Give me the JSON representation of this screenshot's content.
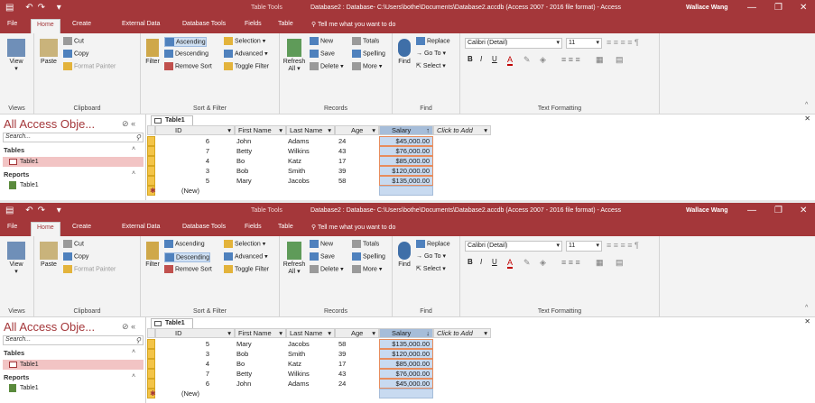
{
  "window_title": "Database2 : Database- C:\\Users\\bothe\\Documents\\Database2.accdb (Access 2007 - 2016 file format) - Access",
  "context_tab": "Table Tools",
  "user_name": "Wallace Wang",
  "tabs": [
    "File",
    "Home",
    "Create",
    "External Data",
    "Database Tools",
    "Fields",
    "Table"
  ],
  "tell_me": "Tell me what you want to do",
  "ribbon": {
    "views": {
      "view": "View",
      "label": "Views"
    },
    "clipboard": {
      "paste": "Paste",
      "cut": "Cut",
      "copy": "Copy",
      "format_painter": "Format Painter",
      "label": "Clipboard"
    },
    "sort_filter": {
      "filter": "Filter",
      "ascending": "Ascending",
      "descending": "Descending",
      "remove_sort": "Remove Sort",
      "selection": "Selection",
      "advanced": "Advanced",
      "toggle_filter": "Toggle Filter",
      "label": "Sort & Filter"
    },
    "records": {
      "refresh": "Refresh",
      "all": "All",
      "new": "New",
      "save": "Save",
      "delete": "Delete",
      "totals": "Totals",
      "spelling": "Spelling",
      "more": "More",
      "label": "Records"
    },
    "find": {
      "find": "Find",
      "replace": "Replace",
      "goto": "Go To",
      "select": "Select",
      "label": "Find"
    },
    "text_formatting": {
      "font": "Calibri (Detail)",
      "size": "11",
      "bold": "B",
      "italic": "I",
      "underline": "U",
      "font_color": "A",
      "label": "Text Formatting"
    }
  },
  "nav": {
    "header": "All Access Obje...",
    "search_placeholder": "Search...",
    "sections": [
      {
        "title": "Tables",
        "items": [
          "Table1"
        ]
      },
      {
        "title": "Reports",
        "items": [
          "Table1"
        ]
      }
    ]
  },
  "doc_tab": "Table1",
  "columns": [
    "ID",
    "First Name",
    "Last Name",
    "Age",
    "Salary",
    "Click to Add"
  ],
  "new_row_label": "(New)",
  "views": [
    {
      "sorted_by": "Ascending",
      "rows": [
        {
          "id": "6",
          "first": "John",
          "last": "Adams",
          "age": "24",
          "salary": "$45,000.00"
        },
        {
          "id": "7",
          "first": "Betty",
          "last": "Wilkins",
          "age": "43",
          "salary": "$76,000.00"
        },
        {
          "id": "4",
          "first": "Bo",
          "last": "Katz",
          "age": "17",
          "salary": "$85,000.00"
        },
        {
          "id": "3",
          "first": "Bob",
          "last": "Smith",
          "age": "39",
          "salary": "$120,000.00"
        },
        {
          "id": "5",
          "first": "Mary",
          "last": "Jacobs",
          "age": "58",
          "salary": "$135,000.00"
        }
      ]
    },
    {
      "sorted_by": "Descending",
      "rows": [
        {
          "id": "5",
          "first": "Mary",
          "last": "Jacobs",
          "age": "58",
          "salary": "$135,000.00"
        },
        {
          "id": "3",
          "first": "Bob",
          "last": "Smith",
          "age": "39",
          "salary": "$120,000.00"
        },
        {
          "id": "4",
          "first": "Bo",
          "last": "Katz",
          "age": "17",
          "salary": "$85,000.00"
        },
        {
          "id": "7",
          "first": "Betty",
          "last": "Wilkins",
          "age": "43",
          "salary": "$76,000.00"
        },
        {
          "id": "6",
          "first": "John",
          "last": "Adams",
          "age": "24",
          "salary": "$45,000.00"
        }
      ]
    }
  ]
}
